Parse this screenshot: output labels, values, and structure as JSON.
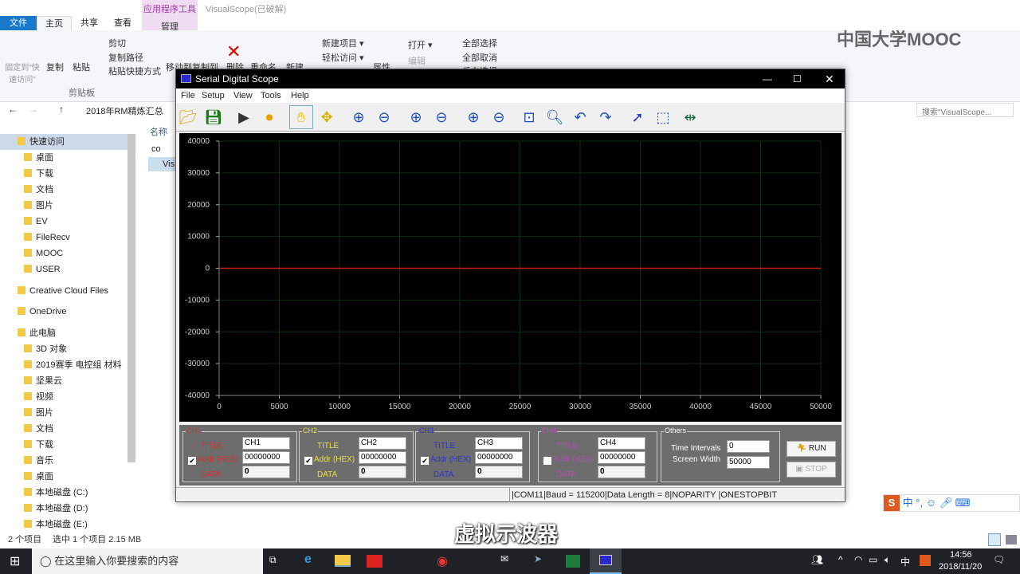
{
  "explorer": {
    "context_tab": "应用程序工具",
    "manage": "管理",
    "window_title": "VisualScope(已破解)",
    "tabs": [
      "文件",
      "主页",
      "共享",
      "查看"
    ],
    "ribbon": {
      "pin": "固定到\"快速访问\"",
      "copy": "复制",
      "paste": "粘贴",
      "cut": "剪切",
      "copy_path": "复制路径",
      "paste_shortcut": "粘贴快捷方式",
      "clipboard": "剪贴板",
      "move_to": "移动到",
      "copy_to": "复制到",
      "delete": "删除",
      "rename": "重命名",
      "new": "新建",
      "new_item": "新建项目 ▾",
      "easy_access": "轻松访问 ▾",
      "properties": "属性",
      "open": "打开 ▾",
      "edit": "编辑",
      "select_all": "全部选择",
      "select_none": "全部取消",
      "invert": "反向选择"
    },
    "breadcrumb": "2018年RM精炼汇总",
    "search_placeholder": "搜索\"VisualScope...",
    "column_name": "名称",
    "files": [
      "co",
      "Vis"
    ],
    "nav": [
      "快速访问",
      "桌面",
      "下载",
      "文档",
      "图片",
      "EV",
      "FileRecv",
      "MOOC",
      "USER",
      "Creative Cloud Files",
      "OneDrive",
      "此电脑",
      "3D 对象",
      "2019赛季 电控组 材料",
      "坚果云",
      "视频",
      "图片",
      "文档",
      "下载",
      "音乐",
      "桌面",
      "本地磁盘 (C:)",
      "本地磁盘 (D:)",
      "本地磁盘 (E:)"
    ],
    "status_items": "2 个项目",
    "status_selected": "选中 1 个项目  2.15 MB"
  },
  "watermark": "中国大学MOOC",
  "subtitle": "虚拟示波器",
  "scope": {
    "title": "Serial Digital Scope",
    "menu": [
      "File",
      "Setup",
      "View",
      "Tools",
      "Help"
    ],
    "toolbar": [
      "open-folder",
      "save",
      "play",
      "stop",
      "hand",
      "move",
      "zoom-in",
      "zoom-out",
      "zoom-in-x",
      "zoom-out-x",
      "zoom-in-y",
      "zoom-out-y",
      "zoom-fit",
      "zoom-window",
      "undo",
      "redo",
      "pointer",
      "select-box",
      "cursor-measure"
    ],
    "channels": [
      {
        "name": "CH1",
        "title_label": "TITLE",
        "addr_label": "Addr (HEX)",
        "data_label": "DATA",
        "title": "CH1",
        "addr": "00000000",
        "data": "0",
        "checked": true,
        "color": "#e03030"
      },
      {
        "name": "CH2",
        "title_label": "TITLE",
        "addr_label": "Addr (HEX)",
        "data_label": "DATA",
        "title": "CH2",
        "addr": "00000000",
        "data": "0",
        "checked": true,
        "color": "#e8e040"
      },
      {
        "name": "CH3",
        "title_label": "TITLE",
        "addr_label": "Addr (HEX)",
        "data_label": "DATA",
        "title": "CH3",
        "addr": "00000000",
        "data": "0",
        "checked": true,
        "color": "#3030d0"
      },
      {
        "name": "CH4",
        "title_label": "TITLE",
        "addr_label": "Addr (HEX)",
        "data_label": "DATA",
        "title": "CH4",
        "addr": "00000000",
        "data": "0",
        "checked": false,
        "color": "#d040d0"
      }
    ],
    "others": {
      "label": "Others",
      "time_intervals_label": "Time Intervals",
      "time_intervals": "0",
      "screen_width_label": "Screen Width",
      "screen_width": "50000"
    },
    "run": "RUN",
    "stop": "STOP",
    "status": "|COM11|Baud = 115200|Data Length = 8|NOPARITY  |ONESTOPBIT"
  },
  "chart_data": {
    "type": "line",
    "title": "",
    "xlabel": "",
    "ylabel": "",
    "xlim": [
      0,
      50000
    ],
    "ylim": [
      -40000,
      40000
    ],
    "xticks": [
      0,
      5000,
      10000,
      15000,
      20000,
      25000,
      30000,
      35000,
      40000,
      45000,
      50000
    ],
    "yticks": [
      40000,
      30000,
      20000,
      10000,
      0,
      -10000,
      -20000,
      -30000,
      -40000
    ],
    "grid": true,
    "background": "#000000",
    "series": [
      {
        "x": [
          0,
          50000
        ],
        "y": [
          0,
          0
        ],
        "color": "#c02020"
      }
    ]
  },
  "taskbar": {
    "search_placeholder": "在这里输入你要搜索的内容",
    "time": "14:56",
    "date": "2018/11/20",
    "ime": "中"
  },
  "ime_bar": [
    "中",
    "°,"
  ]
}
